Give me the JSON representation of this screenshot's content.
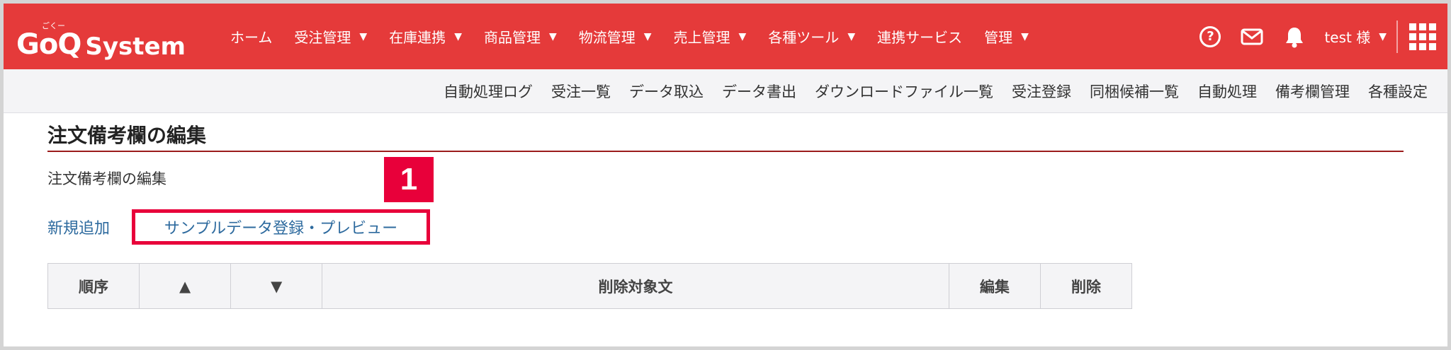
{
  "brand": {
    "logo_main": "GoQ",
    "logo_ruby": "ごくー",
    "logo_sub": "System"
  },
  "nav": {
    "items": [
      {
        "label": "ホーム",
        "dropdown": false
      },
      {
        "label": "受注管理",
        "dropdown": true
      },
      {
        "label": "在庫連携",
        "dropdown": true
      },
      {
        "label": "商品管理",
        "dropdown": true
      },
      {
        "label": "物流管理",
        "dropdown": true
      },
      {
        "label": "売上管理",
        "dropdown": true
      },
      {
        "label": "各種ツール",
        "dropdown": true
      },
      {
        "label": "連携サービス",
        "dropdown": false
      },
      {
        "label": "管理",
        "dropdown": true
      }
    ],
    "caret": "▼"
  },
  "header": {
    "help_glyph": "?",
    "user_label": "test 様"
  },
  "subnav": {
    "items": [
      "自動処理ログ",
      "受注一覧",
      "データ取込",
      "データ書出",
      "ダウンロードファイル一覧",
      "受注登録",
      "同梱候補一覧",
      "自動処理",
      "備考欄管理",
      "各種設定"
    ]
  },
  "page": {
    "title": "注文備考欄の編集",
    "description": "注文備考欄の編集",
    "new_link": "新規追加",
    "sample_link": "サンプルデータ登録・プレビュー",
    "callout_number": "1"
  },
  "table": {
    "headers": [
      "順序",
      "▲",
      "▼",
      "削除対象文",
      "編集",
      "削除"
    ]
  },
  "colors": {
    "brand_red": "#e53a3a",
    "accent_red": "#e8003a",
    "link_blue": "#2d6a9e",
    "rule": "#9b1c1c"
  }
}
